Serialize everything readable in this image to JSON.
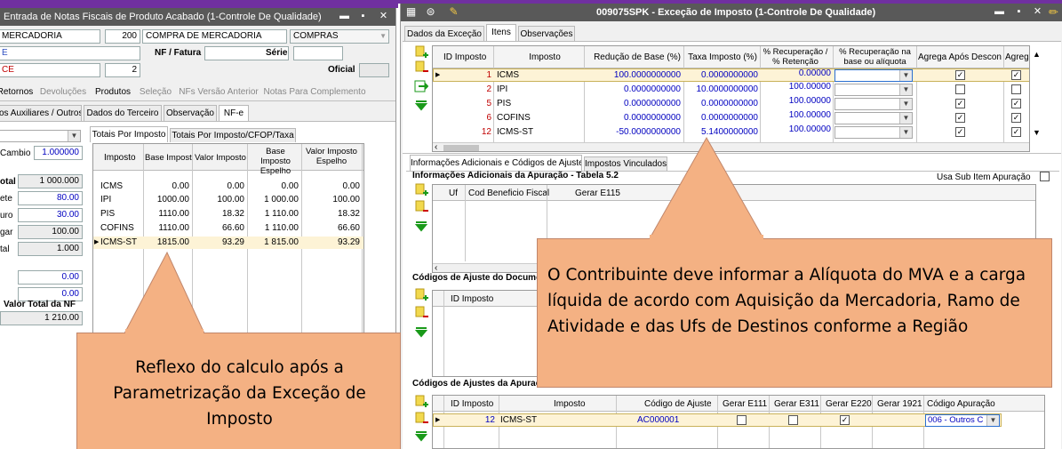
{
  "left": {
    "title": "Entrada de Notas Fiscais de Produto Acabado (1-Controle De Qualidade)",
    "f1": "MERCADORIA",
    "f2": "200",
    "f3": "COMPRA DE MERCADORIA",
    "f4": "COMPRAS",
    "f5": "E",
    "nf_label": "NF / Fatura",
    "serie_label": "Série",
    "f6": "CE",
    "f7": "2",
    "oficial_label": "Oficial",
    "tabs": [
      "Retornos",
      "Devoluções",
      "Produtos",
      "Seleção",
      "NFs Versão Anterior",
      "Notas Para Complemento"
    ],
    "tabs2": [
      "os Auxiliares / Outros",
      "Dados do Terceiro",
      "Observação",
      "NF-e"
    ],
    "cambio_label": "Cambio",
    "cambio": "1.000000",
    "side": [
      {
        "l": "otal",
        "v": "1 000.000"
      },
      {
        "l": "ete",
        "v": "80.00"
      },
      {
        "l": "uro",
        "v": "30.00"
      },
      {
        "l": "gar",
        "v": "100.00"
      },
      {
        "l": "tal",
        "v": "1.000"
      },
      {
        "l": "",
        "v": "0.00"
      },
      {
        "l": "",
        "v": "0.00"
      }
    ],
    "vtotal_label": "Valor Total da NF",
    "vtotal": "1 210.00",
    "subtabs": [
      "Totais Por Imposto",
      "Totais Por Imposto/CFOP/Taxa"
    ],
    "cols": [
      "Imposto",
      "Base Imposto",
      "Valor Imposto",
      "Base Imposto Espelho",
      "Valor Imposto Espelho"
    ],
    "rows": [
      [
        "ICMS",
        "0.00",
        "0.00",
        "0.00",
        "0.00"
      ],
      [
        "IPI",
        "1000.00",
        "100.00",
        "1 000.00",
        "100.00"
      ],
      [
        "PIS",
        "1110.00",
        "18.32",
        "1 110.00",
        "18.32"
      ],
      [
        "COFINS",
        "1110.00",
        "66.60",
        "1 110.00",
        "66.60"
      ],
      [
        "ICMS-ST",
        "1815.00",
        "93.29",
        "1 815.00",
        "93.29"
      ]
    ]
  },
  "right": {
    "title": "009075SPK - Exceção de Imposto (1-Controle De Qualidade)",
    "tabs": [
      "Dados da Exceção",
      "Itens",
      "Observações"
    ],
    "cols": [
      "ID Imposto",
      "Imposto",
      "Redução de Base (%)",
      "Taxa Imposto (%)",
      "% Recuperação / % Retenção",
      "% Recuperação na base ou alíquota",
      "Agrega Após Desconto",
      "Agrega"
    ],
    "rows": [
      {
        "id": "1",
        "imp": "ICMS",
        "red": "100.0000000000",
        "taxa": "0.0000000000",
        "rec": "0.00000",
        "ag": true,
        "ag2": true
      },
      {
        "id": "2",
        "imp": "IPI",
        "red": "0.0000000000",
        "taxa": "10.0000000000",
        "rec": "100.00000",
        "ag": false,
        "ag2": false
      },
      {
        "id": "5",
        "imp": "PIS",
        "red": "0.0000000000",
        "taxa": "0.0000000000",
        "rec": "100.00000",
        "ag": true,
        "ag2": true
      },
      {
        "id": "6",
        "imp": "COFINS",
        "red": "0.0000000000",
        "taxa": "0.0000000000",
        "rec": "100.00000",
        "ag": true,
        "ag2": true
      },
      {
        "id": "12",
        "imp": "ICMS-ST",
        "red": "-50.0000000000",
        "taxa": "5.1400000000",
        "rec": "100.00000",
        "ag": true,
        "ag2": true
      }
    ],
    "subtabs": [
      "Informações Adicionais e Códigos de Ajuste",
      "Impostos Vinculados"
    ],
    "sec1": "Informações Adicionais da Apuração - Tabela 5.2",
    "usa_sub": "Usa Sub Item Apuração",
    "sec1_cols": [
      "Uf",
      "Cod Beneficio Fiscal",
      "Gerar E115"
    ],
    "sec2": "Códigos de Ajuste do Documento",
    "sec2_cols": [
      "ID Imposto"
    ],
    "sec3": "Códigos de Ajustes da Apuração",
    "sec3_cols": [
      "ID Imposto",
      "Imposto",
      "Código de Ajuste",
      "Gerar E111",
      "Gerar E311",
      "Gerar E220",
      "Gerar 1921",
      "Código Apuração"
    ],
    "sec3_row": {
      "id": "12",
      "imp": "ICMS-ST",
      "cod": "AC000001",
      "e220": true,
      "apur": "006 - Outros C"
    }
  },
  "callout1": "Reflexo do calculo após a Parametrização da Exceção de Imposto",
  "callout2": "O Contribuinte deve informar a Alíquota do MVA e a carga líquida  de acordo com Aquisição da Mercadoria, Ramo de Atividade e das Ufs de Destinos conforme a Região",
  "colors": {
    "accent": "#7030a0",
    "title": "#595959",
    "callout": "#f4b183",
    "selrow": "#fdf3d6",
    "id_red": "#c00000",
    "val_blue": "#0000c0"
  }
}
